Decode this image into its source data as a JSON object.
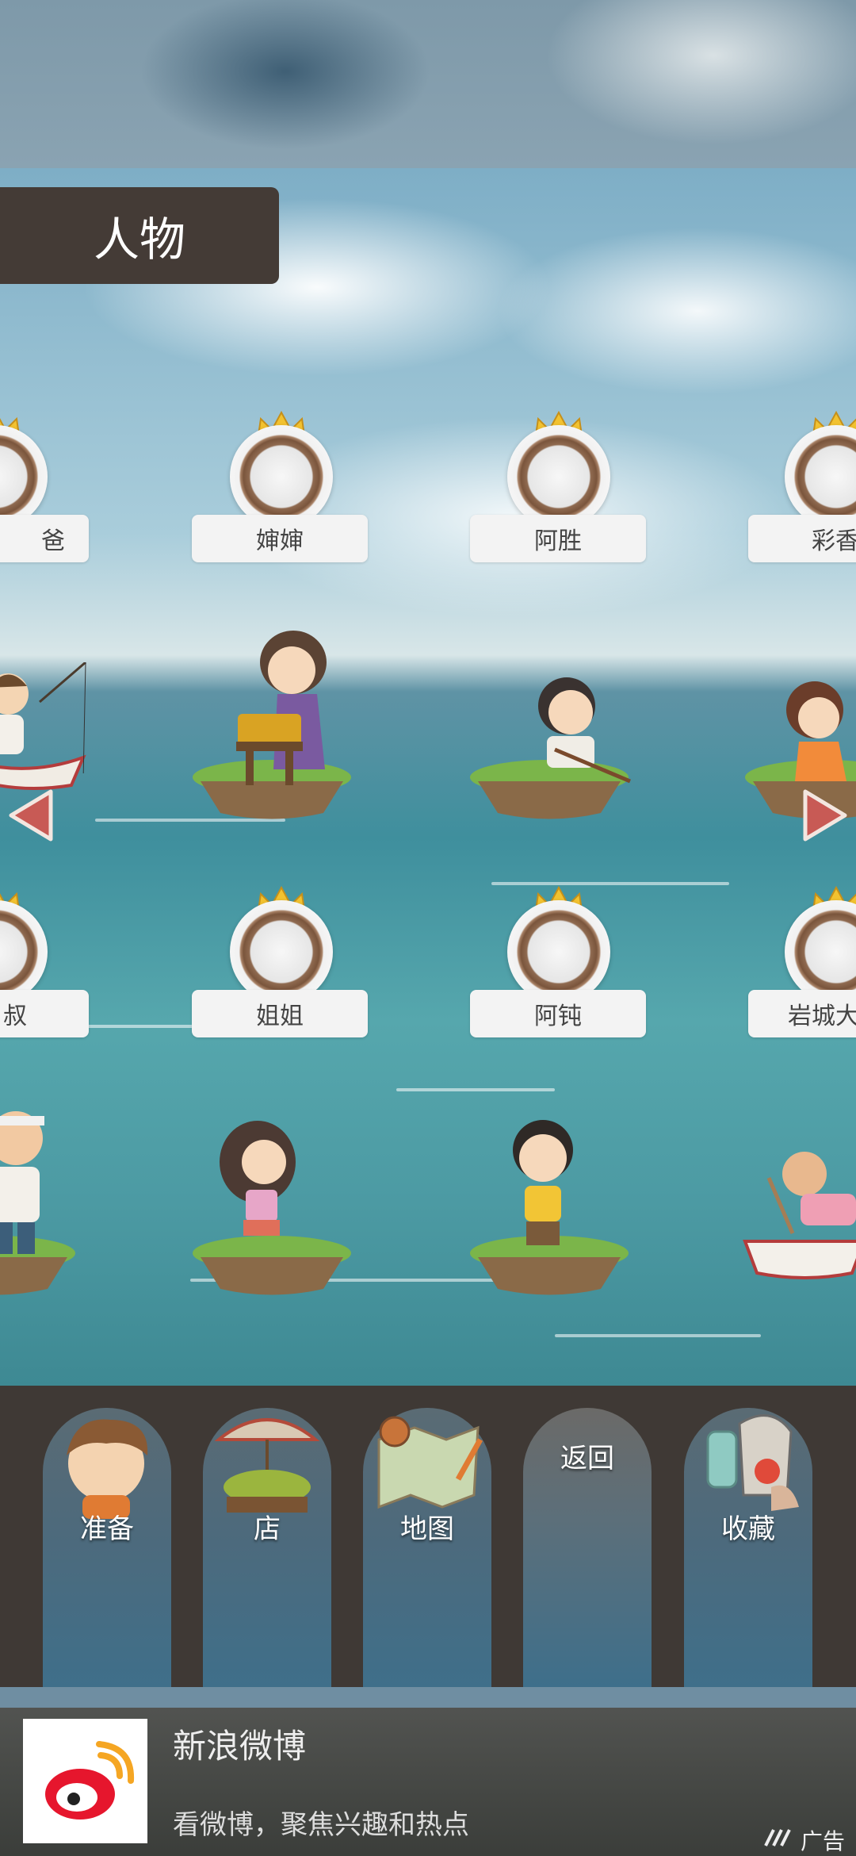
{
  "header": {
    "title": "人物"
  },
  "characters": {
    "row1": [
      {
        "name": "爸爸",
        "visible_text": "爸"
      },
      {
        "name": "婶婶",
        "visible_text": "婶婶"
      },
      {
        "name": "阿胜",
        "visible_text": "阿胜"
      },
      {
        "name": "彩香",
        "visible_text": "彩香"
      }
    ],
    "row2": [
      {
        "name": "叔叔",
        "visible_text": "叔"
      },
      {
        "name": "姐姐",
        "visible_text": "姐姐"
      },
      {
        "name": "阿钝",
        "visible_text": "阿钝"
      },
      {
        "name": "岩城大",
        "visible_text": "岩城大"
      }
    ]
  },
  "navigation": {
    "prepare_label": "准备",
    "shop_label": "店",
    "map_label": "地图",
    "back_label": "返回",
    "collection_label": "收藏"
  },
  "ad": {
    "title": "新浪微博",
    "description": "看微博，聚焦兴趣和热点",
    "tag": "广告"
  },
  "colors": {
    "title_bar": "#443b36",
    "arrow": "#c85a55",
    "nav_bar": "#3f3935",
    "weibo_red": "#e6162d",
    "weibo_orange": "#f5a623"
  }
}
